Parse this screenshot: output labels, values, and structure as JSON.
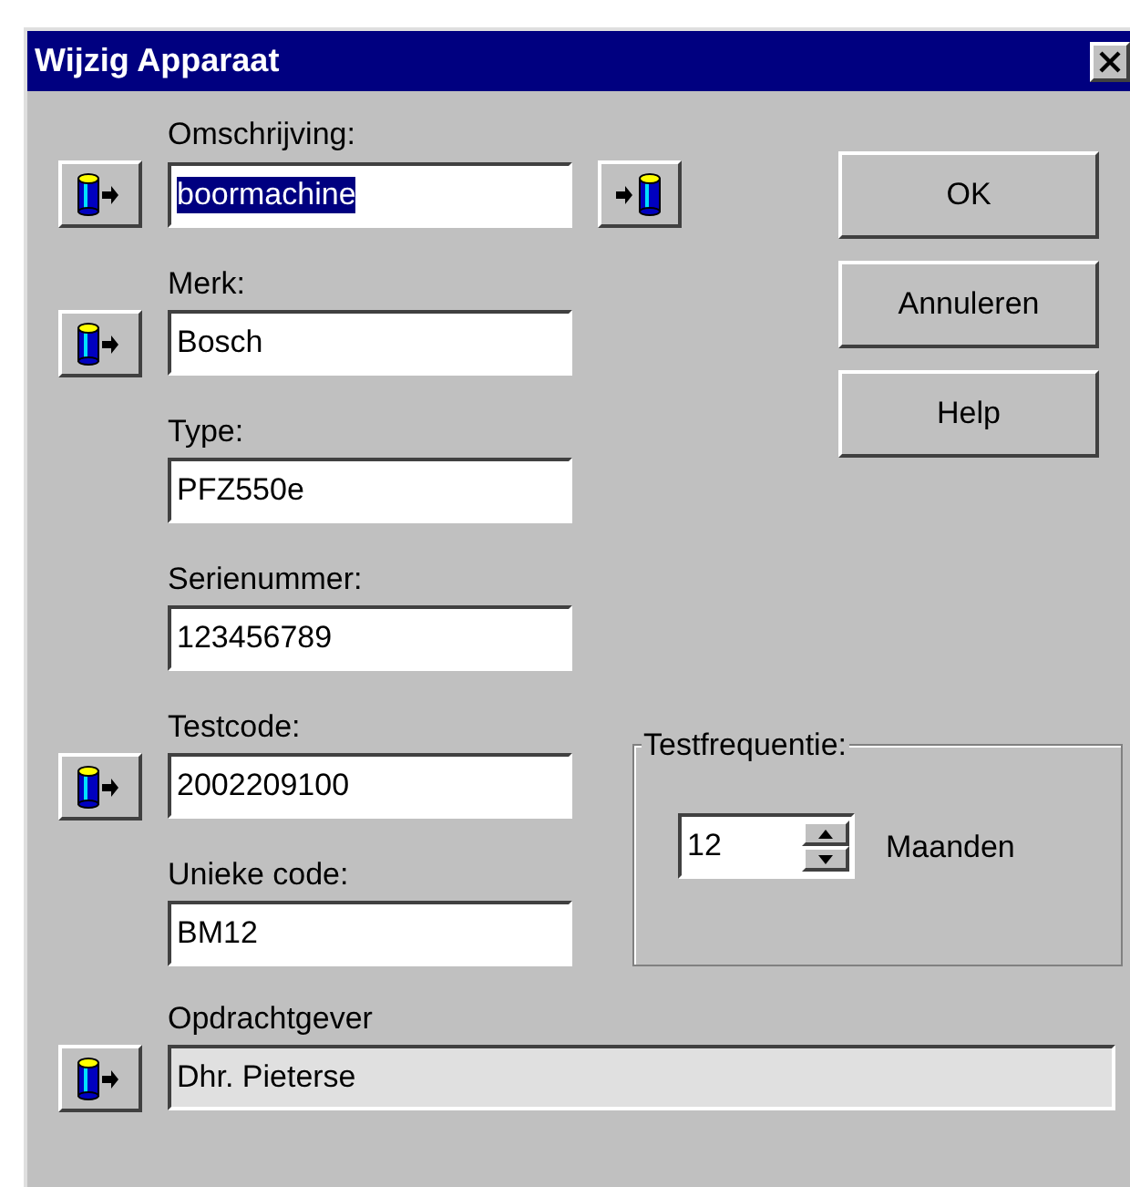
{
  "window": {
    "title": "Wijzig Apparaat"
  },
  "fields": [
    {
      "label": "Omschrijving:",
      "value": "boormachine",
      "selected": true,
      "disabled": false,
      "load_button": true,
      "save_button": true
    },
    {
      "label": "Merk:",
      "value": "Bosch",
      "selected": false,
      "disabled": false,
      "load_button": true,
      "save_button": false
    },
    {
      "label": "Type:",
      "value": "PFZ550e",
      "selected": false,
      "disabled": false,
      "load_button": false,
      "save_button": false
    },
    {
      "label": "Serienummer:",
      "value": "123456789",
      "selected": false,
      "disabled": false,
      "load_button": false,
      "save_button": false
    },
    {
      "label": "Testcode:",
      "value": "2002209100",
      "selected": false,
      "disabled": false,
      "load_button": true,
      "save_button": false
    },
    {
      "label": "Unieke code:",
      "value": "BM12",
      "selected": false,
      "disabled": false,
      "load_button": false,
      "save_button": false
    }
  ],
  "buttons": [
    {
      "label": "OK"
    },
    {
      "label": "Annuleren"
    },
    {
      "label": "Help"
    }
  ],
  "testfrequentie": {
    "title": "Testfrequentie:",
    "value": "12",
    "unit": "Maanden"
  },
  "opdrachtgever": {
    "label": "Opdrachtgever",
    "value": "Dhr. Pieterse",
    "selected": false,
    "disabled": true,
    "load_button": true
  }
}
